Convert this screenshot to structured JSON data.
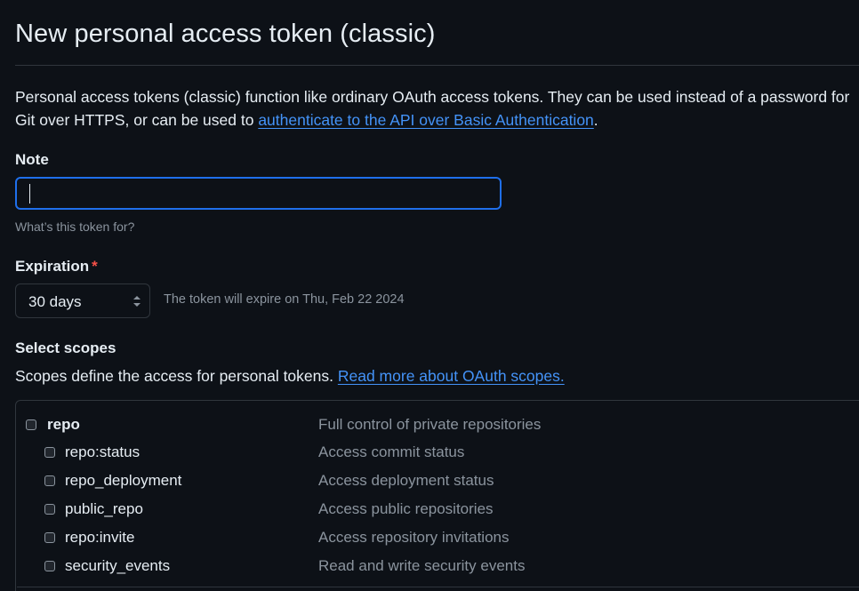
{
  "page": {
    "title": "New personal access token (classic)"
  },
  "intro": {
    "text_before": "Personal access tokens (classic) function like ordinary OAuth access tokens. They can be used instead of a password for Git over HTTPS, or can be used to ",
    "link_text": "authenticate to the API over Basic Authentication",
    "text_after": "."
  },
  "note": {
    "label": "Note",
    "value": "",
    "placeholder": "",
    "hint": "What’s this token for?"
  },
  "expiration": {
    "label": "Expiration",
    "required_mark": "*",
    "selected": "30 days",
    "expire_text": "The token will expire on Thu, Feb 22 2024"
  },
  "scopes": {
    "heading": "Select scopes",
    "description": "Scopes define the access for personal tokens. ",
    "link_text": "Read more about OAuth scopes.",
    "items": [
      {
        "name": "repo",
        "description": "Full control of private repositories",
        "checked": false,
        "parent": true
      },
      {
        "name": "repo:status",
        "description": "Access commit status",
        "checked": false,
        "parent": false
      },
      {
        "name": "repo_deployment",
        "description": "Access deployment status",
        "checked": false,
        "parent": false
      },
      {
        "name": "public_repo",
        "description": "Access public repositories",
        "checked": false,
        "parent": false
      },
      {
        "name": "repo:invite",
        "description": "Access repository invitations",
        "checked": false,
        "parent": false
      },
      {
        "name": "security_events",
        "description": "Read and write security events",
        "checked": false,
        "parent": false
      }
    ]
  },
  "colors": {
    "background": "#0d1117",
    "text": "#e6edf3",
    "muted": "#8b949e",
    "link": "#4493f8",
    "focus_border": "#1f6feb",
    "required": "#f85149",
    "border": "#30363d"
  }
}
